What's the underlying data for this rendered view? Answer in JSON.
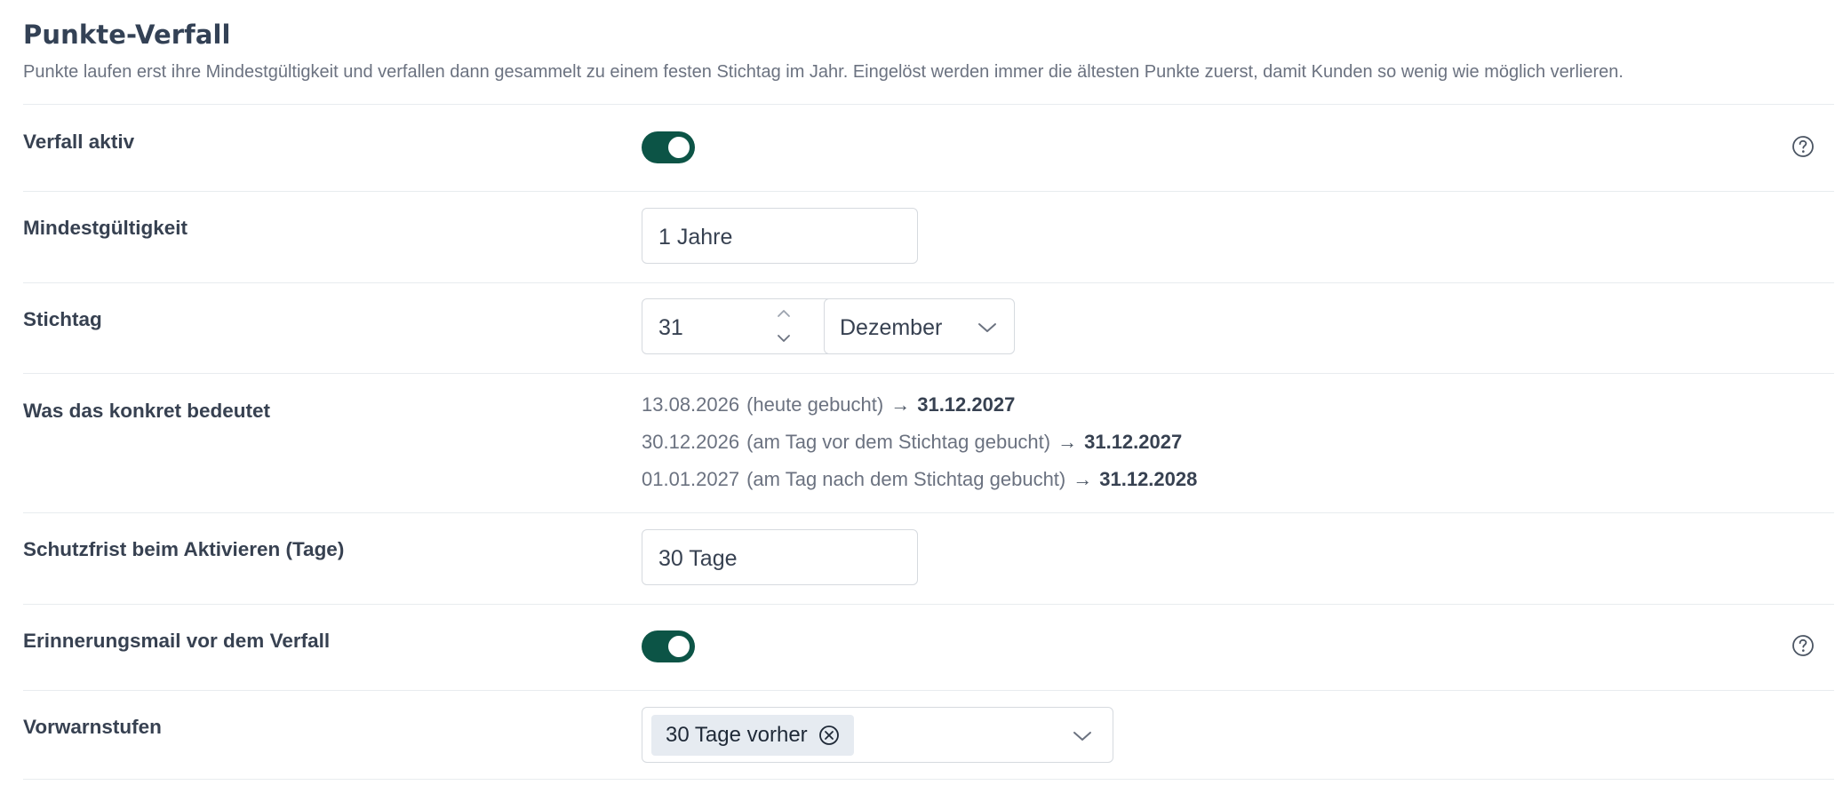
{
  "section": {
    "title": "Punkte-Verfall",
    "subtitle": "Punkte laufen erst ihre Mindestgültigkeit und verfallen dann gesammelt zu einem festen Stichtag im Jahr. Eingelöst werden immer die ältesten Punkte zuerst, damit Kunden so wenig wie möglich verlieren."
  },
  "rows": {
    "verfall_aktiv": {
      "label": "Verfall aktiv",
      "on": true
    },
    "mindestgueltigkeit": {
      "label": "Mindestgültigkeit",
      "value": "1 Jahre"
    },
    "stichtag": {
      "label": "Stichtag",
      "day": "31",
      "month": "Dezember"
    },
    "bedeutung": {
      "label": "Was das konkret bedeutet",
      "examples": [
        {
          "date": "13.08.2026",
          "note": "(heute gebucht)",
          "arrow": "→",
          "result": "31.12.2027"
        },
        {
          "date": "30.12.2026",
          "note": "(am Tag vor dem Stichtag gebucht)",
          "arrow": "→",
          "result": "31.12.2027"
        },
        {
          "date": "01.01.2027",
          "note": "(am Tag nach dem Stichtag gebucht)",
          "arrow": "→",
          "result": "31.12.2028"
        }
      ]
    },
    "schutzfrist": {
      "label": "Schutzfrist beim Aktivieren (Tage)",
      "value": "30 Tage"
    },
    "erinnerungsmail": {
      "label": "Erinnerungsmail vor dem Verfall",
      "on": true
    },
    "vorwarnstufen": {
      "label": "Vorwarnstufen",
      "tags": [
        "30 Tage vorher"
      ]
    }
  },
  "colors": {
    "toggle_on": "#0c5446",
    "title": "#334155",
    "muted_text": "#6b7280",
    "tag_bg": "#e6ebf1"
  },
  "icons": [
    "help-circle-icon",
    "chevron-up-icon",
    "chevron-down-icon",
    "close-circle-icon"
  ]
}
